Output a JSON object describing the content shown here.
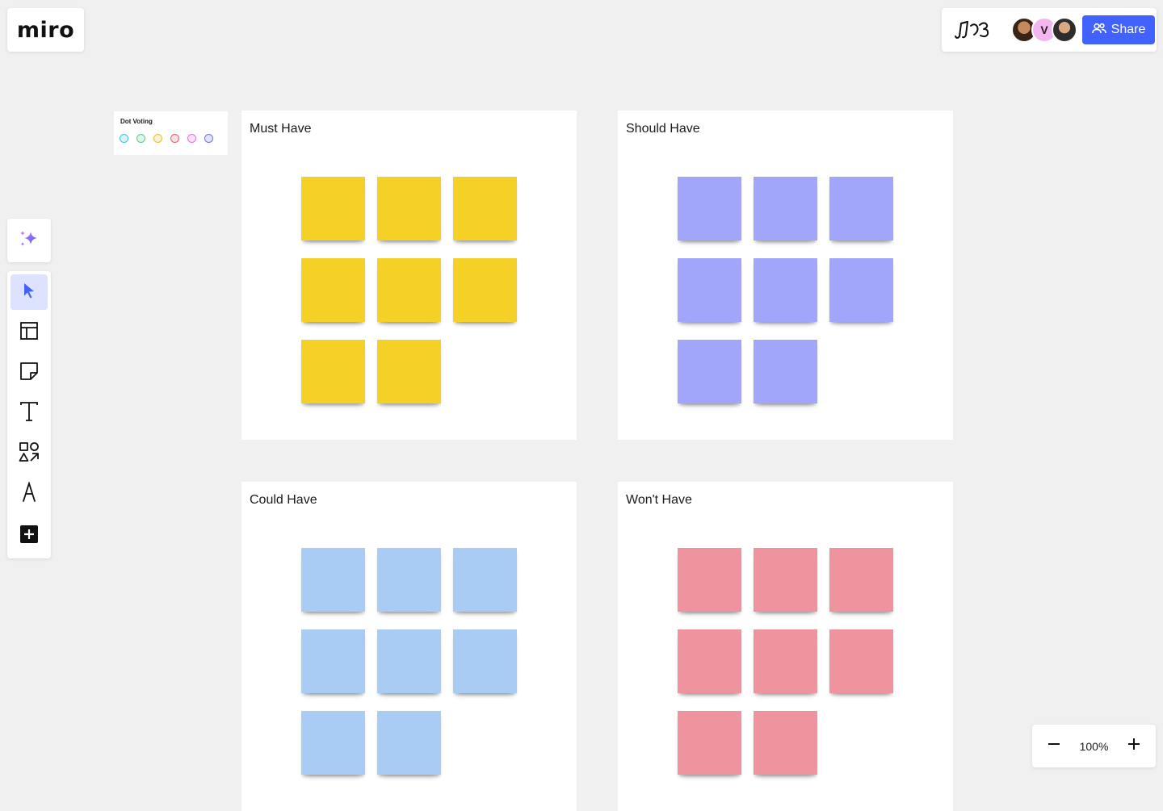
{
  "app": {
    "logo": "miro"
  },
  "header": {
    "collaborators": [
      {
        "initial": ""
      },
      {
        "initial": "V"
      },
      {
        "initial": ""
      }
    ],
    "share_label": "Share"
  },
  "dot_voting": {
    "title": "Dot Voting",
    "dot_colors": [
      "#3fc7d9",
      "#5ccc87",
      "#e3c12e",
      "#e0626c",
      "#e56ee0",
      "#6f73e8"
    ]
  },
  "toolbar": {
    "tools": [
      "select-tool",
      "templates-tool",
      "sticky-note-tool",
      "text-tool",
      "shapes-tool",
      "pen-tool",
      "more-apps-tool"
    ]
  },
  "frames": [
    {
      "title": "Must Have",
      "note_color": "#f5d128",
      "note_count": 8
    },
    {
      "title": "Should Have",
      "note_color": "#a1a6fb",
      "note_count": 8
    },
    {
      "title": "Could Have",
      "note_color": "#a9ccf5",
      "note_count": 8
    },
    {
      "title": "Won't Have",
      "note_color": "#ef939e",
      "note_count": 8
    }
  ],
  "zoom": {
    "level": "100%"
  }
}
